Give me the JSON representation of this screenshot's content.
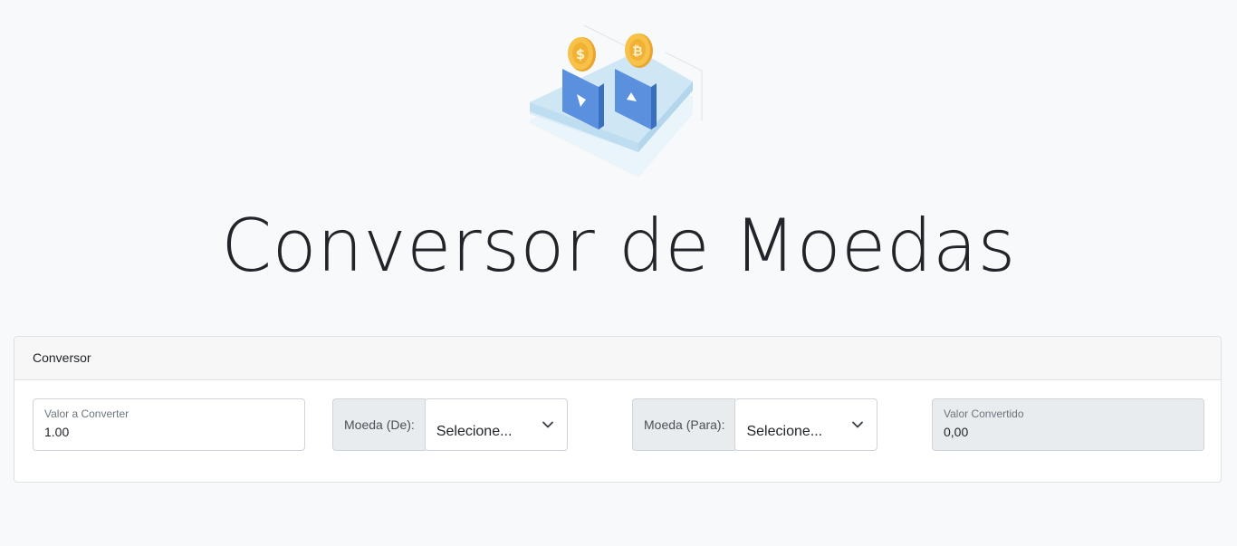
{
  "page": {
    "title": "Conversor de Moedas"
  },
  "illustration": {
    "icon": "currency-exchange-illustration",
    "coin_left_symbol": "$",
    "coin_right_symbol": "₿",
    "colors": {
      "coin": "#f5b83d",
      "panel": "#4f87d8",
      "platform": "#cde6f5"
    }
  },
  "card": {
    "header": "Conversor",
    "amount_field": {
      "label": "Valor a Converter",
      "value": "1.00"
    },
    "from_group": {
      "addon_label": "Moeda (De):",
      "selected": "Selecione...",
      "icon": "chevron-down-icon"
    },
    "to_group": {
      "addon_label": "Moeda (Para):",
      "selected": "Selecione...",
      "icon": "chevron-down-icon"
    },
    "result_field": {
      "label": "Valor Convertido",
      "value": "0,00"
    }
  }
}
